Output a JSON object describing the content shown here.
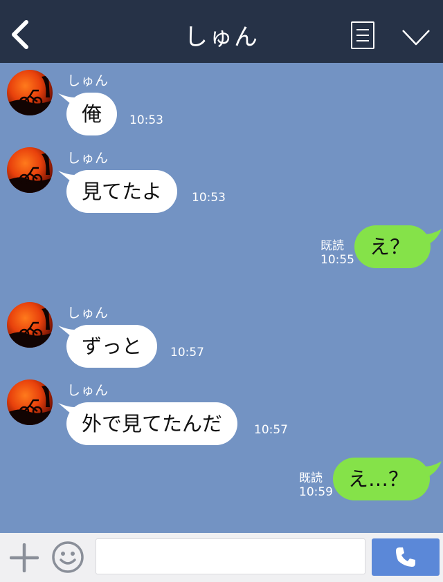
{
  "header": {
    "title": "しゅん"
  },
  "messages": [
    {
      "sender": "しゅん",
      "text": "俺",
      "time": "10:53"
    },
    {
      "sender": "しゅん",
      "text": "見てたよ",
      "time": "10:53"
    },
    {
      "text": "え？",
      "read": "既読",
      "time": "10:55"
    },
    {
      "sender": "しゅん",
      "text": "ずっと",
      "time": "10:57"
    },
    {
      "sender": "しゅん",
      "text": "外で見てたんだ",
      "time": "10:57"
    },
    {
      "text": "え…？",
      "read": "既読",
      "time": "10:59"
    }
  ],
  "composer": {
    "placeholder": ""
  },
  "colors": {
    "header_bg": "#263247",
    "chat_bg": "#7393c3",
    "incoming_bubble": "#ffffff",
    "outgoing_bubble": "#85e249",
    "call_button": "#5b88d8"
  }
}
